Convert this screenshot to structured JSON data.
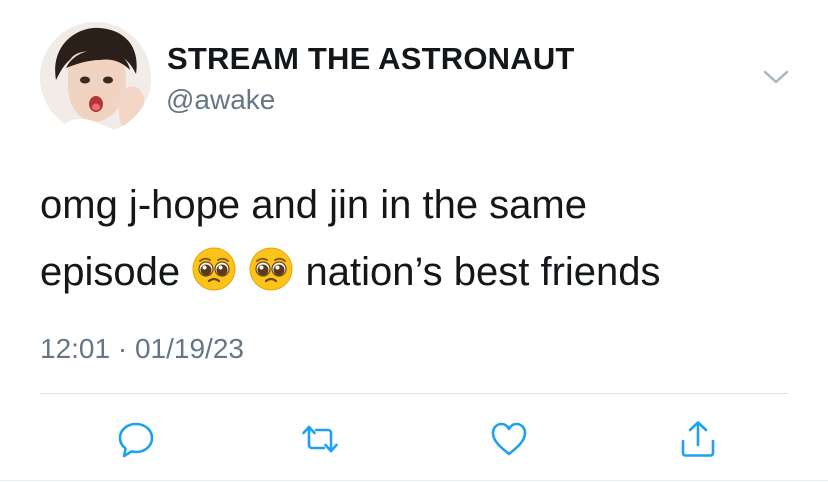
{
  "author": {
    "display_name": "STREAM THE ASTRONAUT",
    "handle": "@awake",
    "avatar_icon": "profile-photo"
  },
  "tweet": {
    "line1": "omg j-hope and jin in the same",
    "line2_before": "episode",
    "emoji": [
      "pleading-face-emoji",
      "pleading-face-emoji"
    ],
    "line2_after": "nation’s best friends",
    "time": "12:01",
    "separator": "·",
    "date": "01/19/23"
  },
  "actions": [
    "reply-icon",
    "retweet-icon",
    "like-icon",
    "share-icon"
  ],
  "colors": {
    "text": "#14171a",
    "secondary": "#657786",
    "action_icon": "#1da1f2",
    "divider": "#dbe2e8"
  }
}
